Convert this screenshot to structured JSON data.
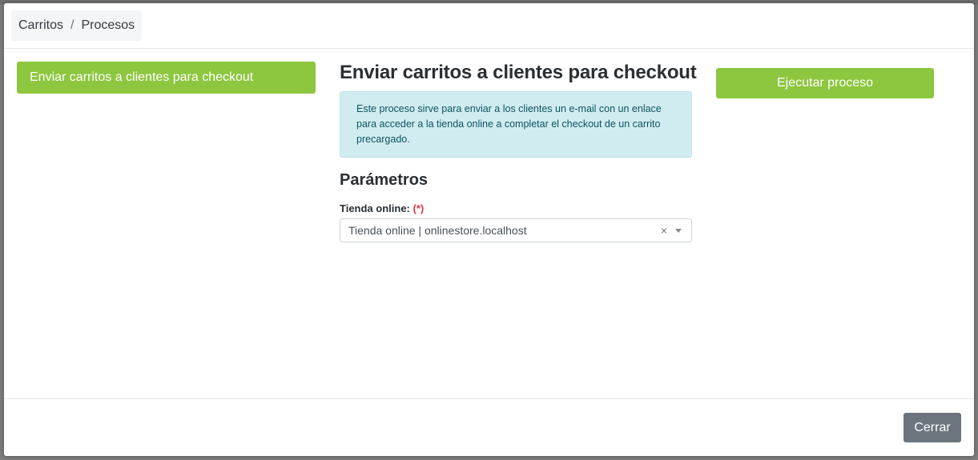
{
  "breadcrumb": {
    "items": [
      "Carritos",
      "Procesos"
    ],
    "separator": "/"
  },
  "sidebar": {
    "items": [
      {
        "label": "Enviar carritos a clientes para checkout",
        "active": true
      }
    ]
  },
  "main": {
    "title": "Enviar carritos a clientes para checkout",
    "info": "Este proceso sirve para enviar a los clientes un e-mail con un enlace para acceder a la tienda online a completar el checkout de un carrito precargado.",
    "params_title": "Parámetros",
    "field": {
      "label": "Tienda online:",
      "required_mark": "(*)",
      "value": "Tienda online | onlinestore.localhost",
      "clear_glyph": "×"
    }
  },
  "actions": {
    "run_label": "Ejecutar proceso",
    "close_label": "Cerrar"
  },
  "colors": {
    "accent": "#8dc63f",
    "info_bg": "#d1ecf1",
    "secondary": "#6c757d",
    "required": "#dc3545"
  }
}
